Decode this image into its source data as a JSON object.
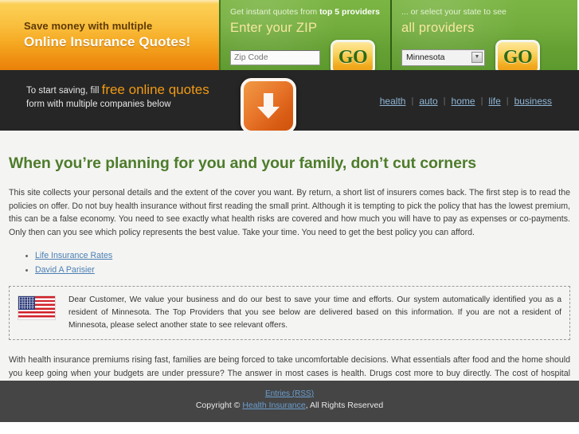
{
  "banner": {
    "promo": {
      "line1": "Save money with multiple",
      "line2": "Online Insurance Quotes!"
    },
    "zip_panel": {
      "sub_prefix": "Get instant quotes from ",
      "sub_strong": "top 5 providers",
      "title": "Enter your ZIP",
      "input_placeholder": "Zip Code",
      "input_value": "",
      "go_label": "GO"
    },
    "state_panel": {
      "sub": "... or select your state to see",
      "title": "all providers",
      "select_value": "Minnesota",
      "select_options": [
        "Minnesota"
      ],
      "go_label": "GO"
    }
  },
  "navbar": {
    "tagline_prefix": "To start saving, fill ",
    "tagline_accent": "free online quotes",
    "tagline_line2": "form with multiple companies below",
    "links": [
      {
        "label": "health"
      },
      {
        "label": "auto"
      },
      {
        "label": "home"
      },
      {
        "label": "life"
      },
      {
        "label": "business"
      }
    ],
    "separator": "|"
  },
  "content": {
    "headline": "When you’re planning for you and your family, don’t cut corners",
    "intro_paragraph": "This site collects your personal details and the extent of the cover you want. By return, a short list of insurers comes back. The first step is to read the policies on offer. Do not buy health insurance without first reading the small print. Although it is tempting to pick the policy that has the lowest premium, this can be a false economy. You need to see exactly what health risks are covered and how much you will have to pay as expenses or co-payments. Only then can you see which policy represents the best value. Take your time. You need to get the best policy you can afford.",
    "links": [
      {
        "label": "Life Insurance Rates"
      },
      {
        "label": "David A Parisier"
      }
    ],
    "notice": "Dear Customer, We value your business and do our best to save your time and efforts. Our system automatically identified you as a resident of Minnesota. The Top Providers that you see below are delivered based on this information. If you are not a resident of Minnesota, please select another state to see relevant offers.",
    "closing_paragraph": "With health insurance premiums rising fast, families are being forced to take uncomfortable decisions. What essentials after food and the home should you keep going when your budgets are under pressure? The answer in most cases is health. Drugs cost more to buy directly. The cost of hospital treatment is even more alarming. Insurance is necessary, even though you may have to agree bigger co-payments. The way to get the best cover is to shop around. This site does that for you, contacting all the major insurers, giving you the chance to find the best value-for-money policy."
  },
  "footer": {
    "rss_label": "Entries (RSS)",
    "copyright_prefix": "Copyright © ",
    "site_link": "Health Insurance",
    "copyright_suffix": ", All Rights Reserved"
  },
  "colors": {
    "headline_green": "#4d7c2b",
    "panel_green": "#6fa93a",
    "promo_orange": "#f5a821",
    "accent_orange": "#f09a14",
    "link_blue": "#4a7fb5",
    "dark_bar": "#262626",
    "footer_gray": "#454545"
  }
}
